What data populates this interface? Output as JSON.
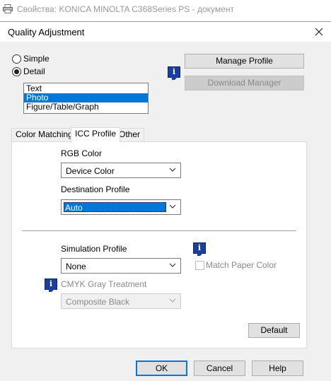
{
  "background_window": {
    "title": "Свойства: KONICA MINOLTA C368Series PS - документ",
    "icon": "printer-icon"
  },
  "dialog": {
    "title": "Quality Adjustment",
    "close_icon": "close-icon"
  },
  "mode": {
    "simple_label": "Simple",
    "detail_label": "Detail",
    "selected": "Detail"
  },
  "type_list": {
    "items": [
      "Text",
      "Photo",
      "Figure/Table/Graph"
    ],
    "selected": "Photo"
  },
  "buttons": {
    "manage_profile": "Manage Profile",
    "download_manager": "Download Manager",
    "default": "Default",
    "ok": "OK",
    "cancel": "Cancel",
    "help": "Help"
  },
  "tabs": {
    "items": [
      "Color Matching",
      "ICC Profile",
      "Other"
    ],
    "active": "ICC Profile"
  },
  "icc": {
    "rgb_color_label": "RGB Color",
    "rgb_color_value": "Device Color",
    "destination_profile_label": "Destination Profile",
    "destination_profile_value": "Auto",
    "simulation_profile_label": "Simulation Profile",
    "simulation_profile_value": "None",
    "match_paper_color_label": "Match Paper Color",
    "match_paper_color_checked": false,
    "cmyk_gray_label": "CMYK Gray Treatment",
    "cmyk_gray_value": "Composite Black"
  },
  "colors": {
    "accent": "#0078d7",
    "info_icon": "#1a3f9c",
    "disabled_text": "#8a8a8a"
  }
}
